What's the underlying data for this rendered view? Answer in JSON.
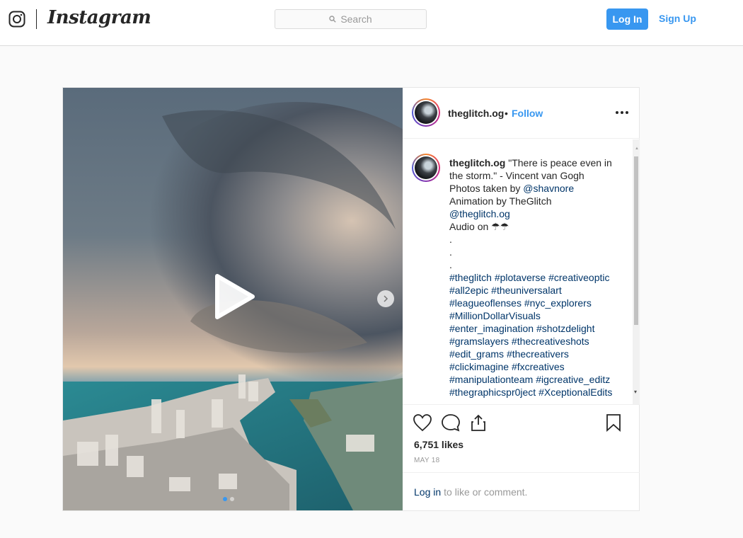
{
  "nav": {
    "brand": "Instagram",
    "search_placeholder": "Search",
    "login_label": "Log In",
    "signup_label": "Sign Up",
    "icons": [
      "instagram-glyph-icon",
      "search-icon"
    ]
  },
  "post": {
    "username": "theglitch.og",
    "separator": "•",
    "follow_label": "Follow",
    "caption_text": "\"There is peace even in the storm.\" - Vincent van Gogh",
    "photos_prefix": "Photos taken by",
    "photos_mention": "@shavnore",
    "animation_line": "Animation by TheGlitch",
    "mention_self": "@theglitch.og",
    "audio_line": "Audio on ☂☂",
    "dot_lines": [
      ".",
      ".",
      "."
    ],
    "hashtag_lines": [
      [
        "#theglitch",
        "#plotaverse",
        "#creativeoptic"
      ],
      [
        "#all2epic",
        "#theuniversalart"
      ],
      [
        "#leagueoflenses",
        "#nyc_explorers"
      ],
      [
        "#MillionDollarVisuals"
      ],
      [
        "#enter_imagination",
        "#shotzdelight"
      ],
      [
        "#gramslayers",
        "#thecreativeshots"
      ],
      [
        "#edit_grams",
        "#thecreativers"
      ],
      [
        "#clickimagine",
        "#fxcreatives"
      ],
      [
        "#manipulationteam",
        "#igcreative_editz"
      ],
      [
        "#thegraphicspr0ject",
        "#XceptionalEdits"
      ]
    ],
    "likes": "6,751 likes",
    "date": "MAY 18",
    "login_link": "Log in",
    "login_suffix": "to like or comment.",
    "carousel": {
      "slides": 2,
      "active": 1
    }
  },
  "colors": {
    "accent": "#3897f0",
    "link": "#003569",
    "text": "#262626",
    "muted": "#999999",
    "border": "#dbdbdb",
    "background": "#fafafa"
  }
}
